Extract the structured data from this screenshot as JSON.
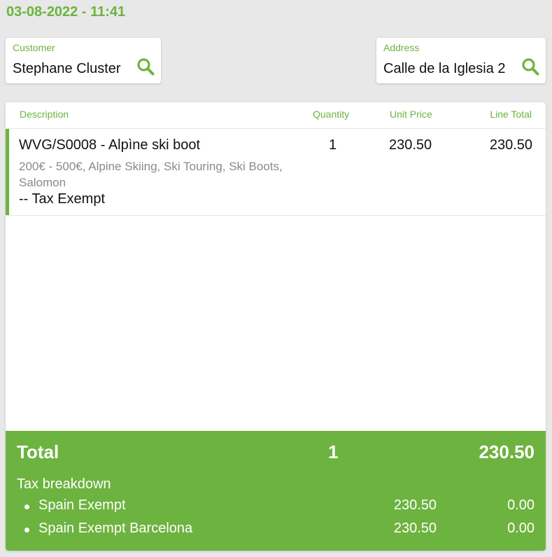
{
  "header": {
    "datetime": "03-08-2022 - 11:41"
  },
  "customer": {
    "label": "Customer",
    "value": "Stephane Cluster",
    "search_icon": "search-icon"
  },
  "address": {
    "label": "Address",
    "value": "Calle de la Iglesia 2",
    "search_icon": "search-icon"
  },
  "lines_table": {
    "columns": [
      "Description",
      "Quantity",
      "Unit Price",
      "Line Total"
    ],
    "rows": [
      {
        "product": "WVG/S0008 - Alpìne ski boot",
        "categories": "200€ - 500€, Alpine Skiing, Ski Touring, Ski Boots, Salomon",
        "tax_note": "-- Tax Exempt",
        "quantity": "1",
        "unit_price": "230.50",
        "line_total": "230.50"
      }
    ]
  },
  "totals": {
    "label": "Total",
    "quantity": "1",
    "amount": "230.50",
    "tax_breakdown_title": "Tax breakdown",
    "tax_breakdown": [
      {
        "name": "Spain Exempt",
        "base": "230.50",
        "amount": "0.00"
      },
      {
        "name": "Spain Exempt Barcelona",
        "base": "230.50",
        "amount": "0.00"
      }
    ]
  },
  "colors": {
    "accent": "#6db33f",
    "background": "#e8e8e8"
  }
}
